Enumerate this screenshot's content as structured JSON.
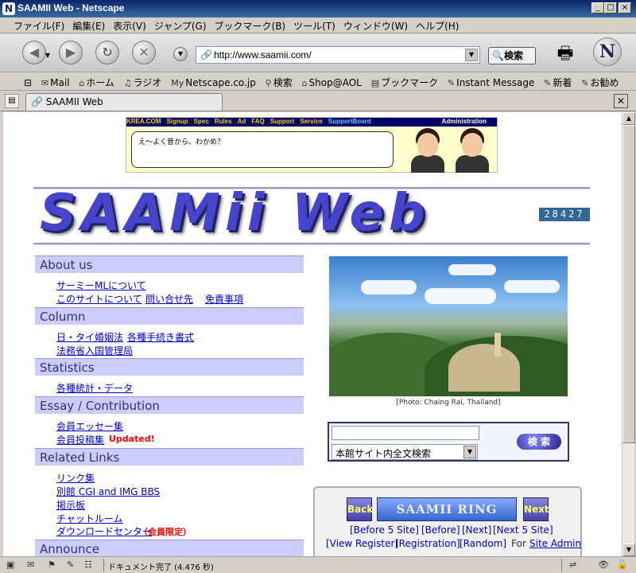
{
  "window": {
    "title": "SAAMII Web - Netscape",
    "app_icon": "N",
    "controls": [
      "_",
      "□",
      "×"
    ]
  },
  "menu": [
    "ファイル(F)",
    "編集(E)",
    "表示(V)",
    "ジャンプ(G)",
    "ブックマーク(B)",
    "ツール(T)",
    "ウィンドウ(W)",
    "ヘルプ(H)"
  ],
  "navbar": {
    "url": "http://www.saamii.com/",
    "search_label": "検索",
    "logo_letter": "N"
  },
  "personal_bar": [
    {
      "icon": "mail-icon",
      "glyph": "✉",
      "label": "Mail"
    },
    {
      "icon": "home-icon",
      "glyph": "⌂",
      "label": "ホーム"
    },
    {
      "icon": "radio-icon",
      "glyph": "♫",
      "label": "ラジオ"
    },
    {
      "icon": "my-icon",
      "glyph": "My",
      "label": "Netscape.co.jp"
    },
    {
      "icon": "search-icon",
      "glyph": "⚲",
      "label": "検索"
    },
    {
      "icon": "shop-icon",
      "glyph": "⌂",
      "label": "Shop@AOL"
    },
    {
      "icon": "bookmark-icon",
      "glyph": "▤",
      "label": "ブックマーク"
    },
    {
      "icon": "im-icon",
      "glyph": "✎",
      "label": "Instant Message"
    },
    {
      "icon": "new-icon",
      "glyph": "✎",
      "label": "新着"
    },
    {
      "icon": "recommend-icon",
      "glyph": "✎",
      "label": "お勧め"
    }
  ],
  "tab": {
    "label": "SAAMII Web"
  },
  "banner": {
    "nav": [
      "KREA.COM",
      "Signup",
      "Spec",
      "Rules",
      "Ad",
      "FAQ",
      "Support",
      "Service",
      "SupportBoard"
    ],
    "admin": "Administration",
    "bubble": "え～よく昔から、わかめ？"
  },
  "site": {
    "logo": "SAAMii Web",
    "counter": "28427"
  },
  "sections": [
    {
      "title": "About us",
      "links": [
        [
          "サーミーMLについて"
        ],
        [
          "このサイトについて",
          "問い合せ先",
          "免責事項"
        ]
      ]
    },
    {
      "title": "Column",
      "links": [
        [
          "日・タイ婚姻法",
          "各種手続き書式"
        ],
        [
          "法務省入国管理局"
        ]
      ]
    },
    {
      "title": "Statistics",
      "links": [
        [
          "各種統計・データ"
        ]
      ]
    },
    {
      "title": "Essay / Contribution",
      "links": [
        [
          "会員エッセー集"
        ],
        [
          "会員投稿集"
        ]
      ],
      "updated": "Updated!"
    },
    {
      "title": "Related Links",
      "links": [
        [
          "リンク集"
        ],
        [
          "別館 CGI and IMG BBS"
        ],
        [
          "掲示板"
        ],
        [
          "チャットルーム"
        ],
        [
          "ダウンロードセンター"
        ]
      ],
      "members_only": "（会員限定）"
    },
    {
      "title": "Announce",
      "links": []
    }
  ],
  "photo": {
    "caption": "[Photo: Chaing Rai, Thailand]"
  },
  "site_search": {
    "query": "",
    "scope": "本館サイト内全文検索",
    "button": "検 索"
  },
  "ring": {
    "prev": "Back",
    "next": "Next",
    "logo": "SAAMII RING",
    "links_row1": [
      "[Before 5 Site]",
      "[Before]",
      "[Next]",
      "[Next 5 Site]"
    ],
    "links_row2": [
      "[View Register]",
      "[Registration]",
      "[Random]"
    ],
    "for_text": "For",
    "admin_link": "Site Admin"
  },
  "status": {
    "text": "ドキュメント完了 (4.476 秒)"
  }
}
